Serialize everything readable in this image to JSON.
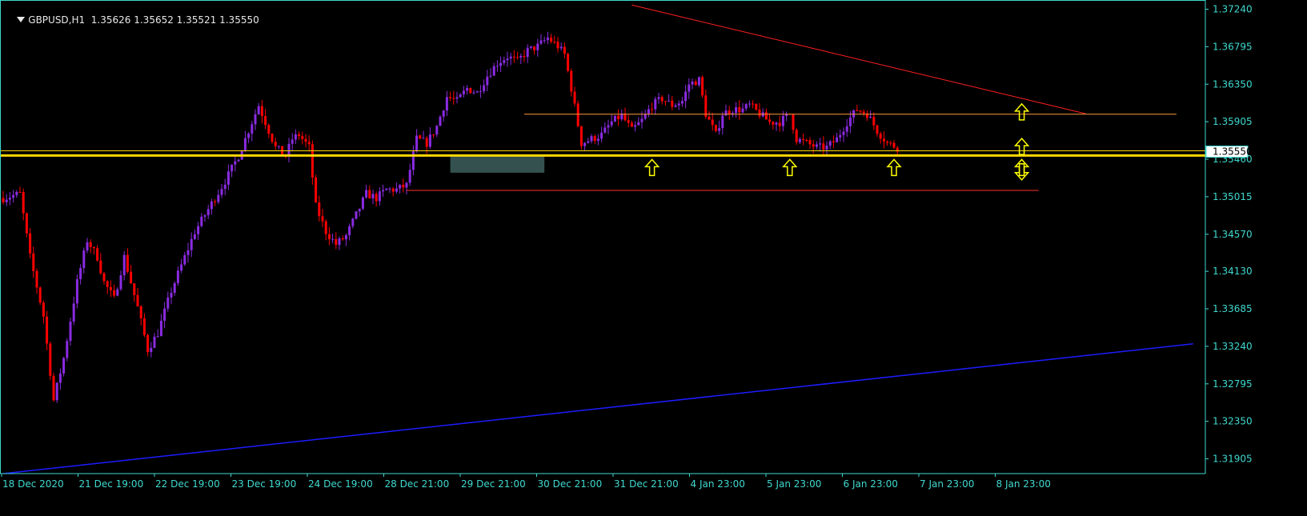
{
  "header": {
    "symbol": "GBPUSD,H1",
    "ohlc": "1.35626 1.35652 1.35521 1.35550"
  },
  "chart_data": {
    "type": "candlestick",
    "symbol": "GBPUSD",
    "timeframe": "H1",
    "colors": {
      "background": "#000000",
      "bull_candle": "#8a2be2",
      "bear_candle": "#ff0000",
      "axis": "#3fd9cf",
      "trend_line_blue": "#1c1cff",
      "trend_line_red": "#ff2020",
      "level_yellow": "#ffd700",
      "level_orange": "#ff9a3c",
      "level_red": "#ff3030",
      "zone": "#3a5a58",
      "arrow": "#ffff00"
    },
    "y_axis": {
      "min": 1.3173,
      "max": 1.3733,
      "ticks": [
        "1.37240",
        "1.36795",
        "1.36350",
        "1.35905",
        "1.35460",
        "1.35015",
        "1.34570",
        "1.34130",
        "1.33685",
        "1.33240",
        "1.32795",
        "1.32350",
        "1.31905"
      ],
      "current_price_label": "1.35550"
    },
    "x_axis": {
      "labels": [
        "18 Dec 2020",
        "21 Dec 19:00",
        "22 Dec 19:00",
        "23 Dec 19:00",
        "24 Dec 19:00",
        "28 Dec 21:00",
        "29 Dec 21:00",
        "30 Dec 21:00",
        "31 Dec 21:00",
        "4 Jan 23:00",
        "5 Jan 23:00",
        "6 Jan 23:00",
        "7 Jan 23:00",
        "8 Jan 23:00"
      ],
      "bars_total": 296,
      "bar_spacing": 4.2
    },
    "price_path": [
      [
        0,
        1.35
      ],
      [
        5,
        1.3505
      ],
      [
        8,
        1.343
      ],
      [
        12,
        1.336
      ],
      [
        15,
        1.326
      ],
      [
        18,
        1.331
      ],
      [
        22,
        1.34
      ],
      [
        25,
        1.345
      ],
      [
        28,
        1.343
      ],
      [
        30,
        1.34
      ],
      [
        33,
        1.338
      ],
      [
        36,
        1.343
      ],
      [
        40,
        1.337
      ],
      [
        43,
        1.332
      ],
      [
        46,
        1.334
      ],
      [
        50,
        1.339
      ],
      [
        53,
        1.342
      ],
      [
        57,
        1.346
      ],
      [
        60,
        1.348
      ],
      [
        63,
        1.35
      ],
      [
        66,
        1.352
      ],
      [
        70,
        1.355
      ],
      [
        73,
        1.358
      ],
      [
        76,
        1.361
      ],
      [
        78,
        1.359
      ],
      [
        81,
        1.356
      ],
      [
        84,
        1.355
      ],
      [
        86,
        1.357
      ],
      [
        88,
        1.3575
      ],
      [
        91,
        1.356
      ],
      [
        93,
        1.349
      ],
      [
        96,
        1.346
      ],
      [
        99,
        1.3445
      ],
      [
        102,
        1.3455
      ],
      [
        105,
        1.348
      ],
      [
        108,
        1.3505
      ],
      [
        111,
        1.35
      ],
      [
        114,
        1.351
      ],
      [
        117,
        1.351
      ],
      [
        120,
        1.3515
      ],
      [
        123,
        1.357
      ],
      [
        126,
        1.3565
      ],
      [
        129,
        1.3585
      ],
      [
        132,
        1.362
      ],
      [
        135,
        1.3615
      ],
      [
        138,
        1.363
      ],
      [
        141,
        1.3625
      ],
      [
        144,
        1.3645
      ],
      [
        147,
        1.366
      ],
      [
        150,
        1.3668
      ],
      [
        153,
        1.3662
      ],
      [
        156,
        1.3675
      ],
      [
        159,
        1.368
      ],
      [
        162,
        1.369
      ],
      [
        165,
        1.368
      ],
      [
        167,
        1.367
      ],
      [
        169,
        1.363
      ],
      [
        172,
        1.3565
      ],
      [
        175,
        1.357
      ],
      [
        178,
        1.3575
      ],
      [
        181,
        1.359
      ],
      [
        184,
        1.3598
      ],
      [
        187,
        1.358
      ],
      [
        190,
        1.3592
      ],
      [
        193,
        1.361
      ],
      [
        196,
        1.3618
      ],
      [
        199,
        1.361
      ],
      [
        202,
        1.3615
      ],
      [
        204,
        1.3635
      ],
      [
        207,
        1.364
      ],
      [
        209,
        1.36
      ],
      [
        212,
        1.3575
      ],
      [
        214,
        1.36
      ],
      [
        217,
        1.3605
      ],
      [
        220,
        1.3605
      ],
      [
        222,
        1.361
      ],
      [
        225,
        1.36
      ],
      [
        228,
        1.359
      ],
      [
        231,
        1.359
      ],
      [
        234,
        1.36
      ],
      [
        236,
        1.357
      ],
      [
        239,
        1.3565
      ],
      [
        242,
        1.356
      ],
      [
        245,
        1.356
      ],
      [
        248,
        1.357
      ],
      [
        251,
        1.359
      ],
      [
        254,
        1.3605
      ],
      [
        257,
        1.36
      ],
      [
        260,
        1.358
      ],
      [
        263,
        1.3565
      ],
      [
        266,
        1.356
      ]
    ],
    "annotations": {
      "blue_trendline": {
        "from": [
          0,
          1.3173
        ],
        "to": [
          354,
          1.3327
        ]
      },
      "red_trendline": {
        "from": [
          187,
          1.3729
        ],
        "to": [
          322,
          1.36
        ]
      },
      "yellow_support_thick": 1.35504,
      "yellow_support_thin": 1.3556,
      "orange_resistance": {
        "price": 1.35994,
        "from_bar": 155,
        "to_bar": 349
      },
      "red_support": {
        "price": 1.3509,
        "from_bar": 120,
        "to_bar": 308
      },
      "zone": {
        "from_bar": 133,
        "to_bar": 161,
        "top": 1.355,
        "bottom": 1.353
      },
      "up_arrows_bars": [
        193,
        234,
        265,
        303
      ],
      "right_arrows": [
        {
          "bar": 303,
          "price": 1.3604,
          "dir": "up"
        },
        {
          "bar": 303,
          "price": 1.3563,
          "dir": "up"
        },
        {
          "bar": 303,
          "price": 1.3532,
          "dir": "down"
        }
      ]
    }
  }
}
